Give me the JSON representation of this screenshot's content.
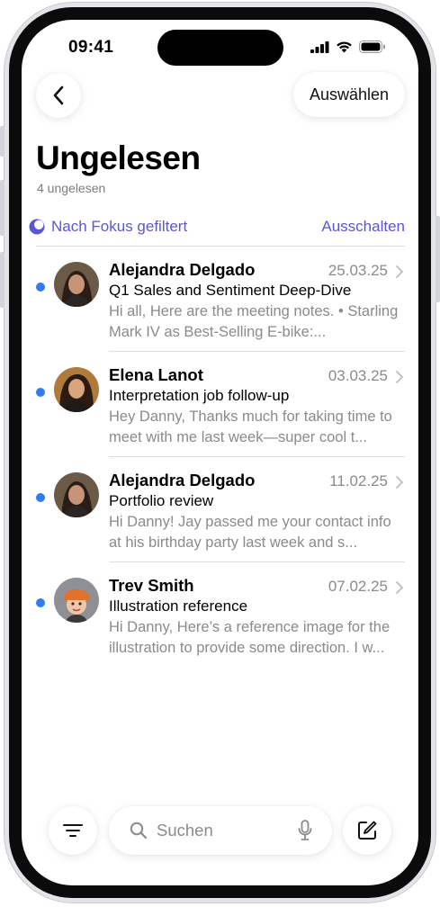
{
  "status_bar": {
    "time": "09:41"
  },
  "header": {
    "back_icon": "chevron-left-icon",
    "select_label": "Auswählen",
    "title": "Ungelesen",
    "unread_count": "4 ungelesen"
  },
  "focus_filter": {
    "icon": "moon-icon",
    "label": "Nach Fokus gefiltert",
    "action_label": "Ausschalten",
    "accent_color": "#5a56d6"
  },
  "messages": [
    {
      "sender": "Alejandra Delgado",
      "date": "25.03.25",
      "subject": "Q1 Sales and Sentiment Deep-Dive",
      "preview": "Hi all, Here are the meeting notes. • Starling Mark IV as Best-Selling E-bike:...",
      "unread": true
    },
    {
      "sender": "Elena Lanot",
      "date": "03.03.25",
      "subject": "Interpretation job follow-up",
      "preview": "Hey Danny, Thanks much for taking time to meet with me last week—super cool t...",
      "unread": true
    },
    {
      "sender": "Alejandra Delgado",
      "date": "11.02.25",
      "subject": "Portfolio review",
      "preview": "Hi Danny! Jay passed me your contact info at his birthday party last week and s...",
      "unread": true
    },
    {
      "sender": "Trev Smith",
      "date": "07.02.25",
      "subject": "Illustration reference",
      "preview": "Hi Danny, Here’s a reference image for the illustration to provide some direction. I w...",
      "unread": true
    }
  ],
  "bottom_bar": {
    "filter_icon": "filter-lines-icon",
    "search_placeholder": "Suchen",
    "search_icon": "magnifier-icon",
    "mic_icon": "microphone-icon",
    "compose_icon": "compose-icon"
  },
  "colors": {
    "unread_dot": "#2f7cf6",
    "secondary_text": "#8a8a8f"
  }
}
